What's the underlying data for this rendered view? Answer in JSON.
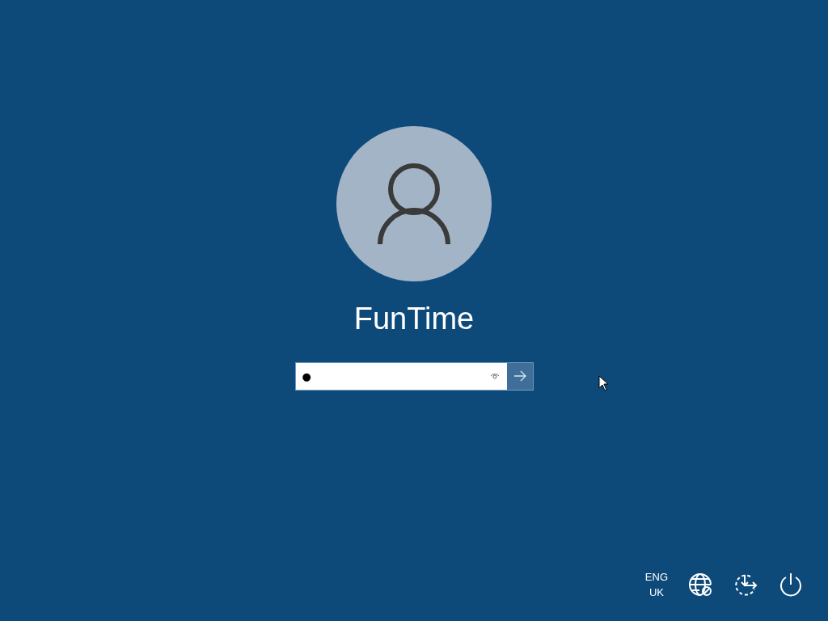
{
  "user": {
    "name": "FunTime"
  },
  "password": {
    "value": "●",
    "reveal_button": true
  },
  "tray": {
    "language": [
      "ENG",
      "UK"
    ]
  }
}
